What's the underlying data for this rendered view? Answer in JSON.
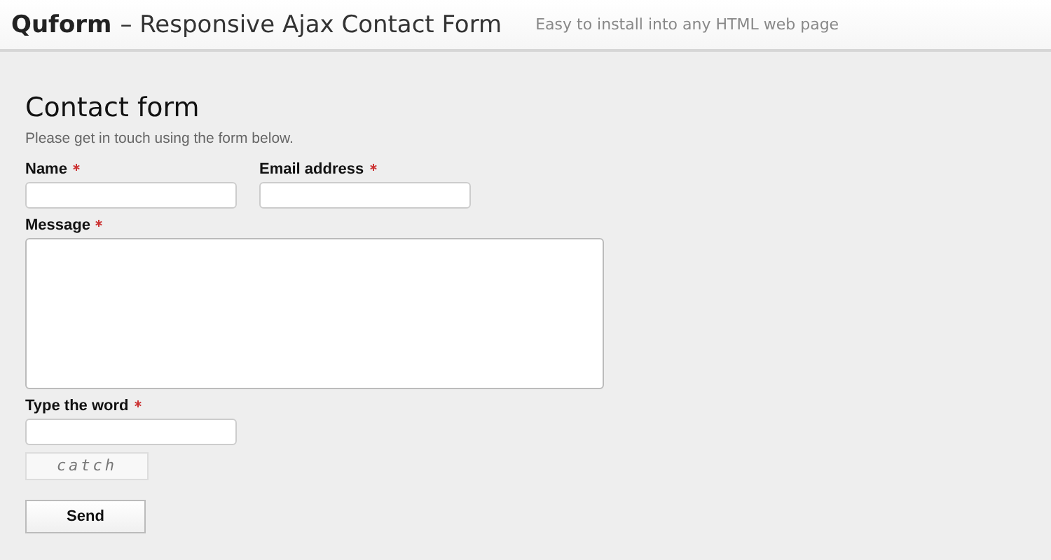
{
  "header": {
    "brand": "Quform",
    "title": "– Responsive Ajax Contact Form",
    "tagline": "Easy to install into any HTML web page"
  },
  "form": {
    "title": "Contact form",
    "subtitle": "Please get in touch using the form below.",
    "rows": [
      [
        {
          "label": "Name",
          "required": true,
          "kind": "text"
        },
        {
          "label": "Email address",
          "required": true,
          "kind": "text"
        }
      ],
      [
        {
          "label": "Message",
          "required": true,
          "kind": "textarea"
        }
      ],
      [
        {
          "label": "Type the word",
          "required": true,
          "kind": "text"
        }
      ]
    ],
    "captcha": "catch",
    "submit": "Send"
  }
}
